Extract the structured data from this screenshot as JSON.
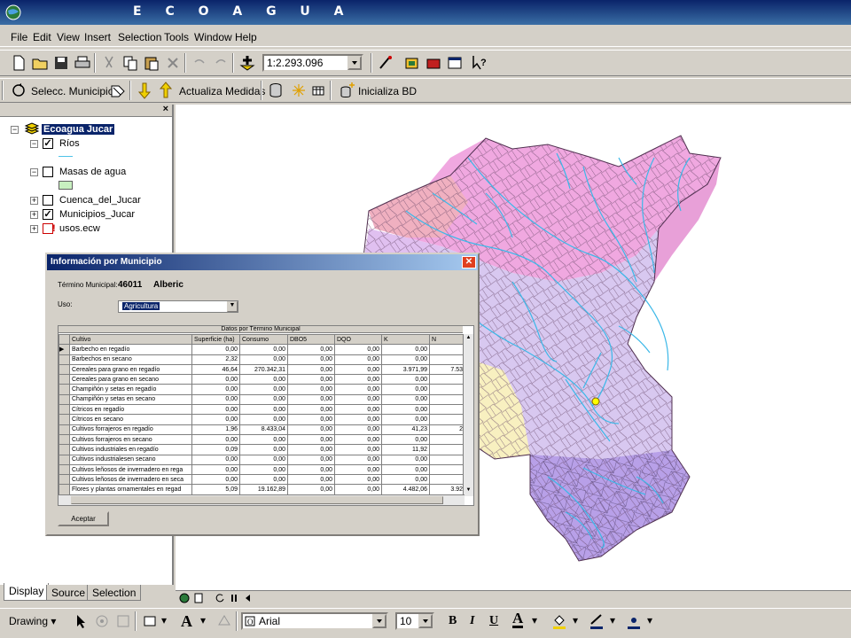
{
  "app": {
    "title": "E C O A G U A"
  },
  "menu": [
    "File",
    "Edit",
    "View",
    "Insert",
    "Selection",
    "Tools",
    "Window",
    "Help"
  ],
  "toolbar": {
    "scale": "1:2.293.096",
    "selecc_municipio": "Selecc. Municipio",
    "actualiza_medidas": "Actualiza Medidas",
    "inicializa_bd": "Inicializa BD"
  },
  "toc": {
    "root": "Ecoagua Jucar",
    "layers": [
      {
        "name": "Ríos",
        "checked": true
      },
      {
        "name": "Masas de agua",
        "checked": false
      },
      {
        "name": "Cuenca_del_Jucar",
        "checked": false
      },
      {
        "name": "Municipios_Jucar",
        "checked": true
      },
      {
        "name": "usos.ecw",
        "checked": false
      }
    ],
    "tabs": [
      "Display",
      "Source",
      "Selection"
    ]
  },
  "drawing": {
    "label": "Drawing",
    "font": "Arial",
    "size": "10"
  },
  "dialog": {
    "title": "Información por Municipio",
    "termino_label": "Término Municipal:",
    "termino_code": "46011",
    "termino_name": "Alberic",
    "uso_label": "Uso:",
    "uso_value": "Agricultura",
    "grid_caption": "Datos por Término Municipal",
    "columns": [
      "Cultivo",
      "Superficie (ha)",
      "Consumo",
      "DBO5",
      "DQO",
      "K",
      "N"
    ],
    "rows": [
      [
        "Barbecho en regadío",
        "0,00",
        "0,00",
        "0,00",
        "0,00",
        "0,00",
        ""
      ],
      [
        "Barbechos en secano",
        "2,32",
        "0,00",
        "0,00",
        "0,00",
        "0,00",
        ""
      ],
      [
        "Cereales para grano en regadío",
        "46,64",
        "270.342,31",
        "0,00",
        "0,00",
        "3.971,99",
        "7.53"
      ],
      [
        "Cereales para grano en secano",
        "0,00",
        "0,00",
        "0,00",
        "0,00",
        "0,00",
        ""
      ],
      [
        "Champiñón y setas en regadío",
        "0,00",
        "0,00",
        "0,00",
        "0,00",
        "0,00",
        ""
      ],
      [
        "Champiñón y setas en secano",
        "0,00",
        "0,00",
        "0,00",
        "0,00",
        "0,00",
        ""
      ],
      [
        "Cítricos en regadío",
        "0,00",
        "0,00",
        "0,00",
        "0,00",
        "0,00",
        ""
      ],
      [
        "Cítricos en secano",
        "0,00",
        "0,00",
        "0,00",
        "0,00",
        "0,00",
        ""
      ],
      [
        "Cultivos forrajeros en regadío",
        "1,96",
        "8.433,04",
        "0,00",
        "0,00",
        "41,23",
        "2"
      ],
      [
        "Cultivos forrajeros en secano",
        "0,00",
        "0,00",
        "0,00",
        "0,00",
        "0,00",
        ""
      ],
      [
        "Cultivos industriales en regadío",
        "0,09",
        "0,00",
        "0,00",
        "0,00",
        "11,92",
        ""
      ],
      [
        "Cultivos industrialesen secano",
        "0,00",
        "0,00",
        "0,00",
        "0,00",
        "0,00",
        ""
      ],
      [
        "Cultivos leñosos de invernadero en rega",
        "0,00",
        "0,00",
        "0,00",
        "0,00",
        "0,00",
        ""
      ],
      [
        "Cultivos leñosos de invernadero en seca",
        "0,00",
        "0,00",
        "0,00",
        "0,00",
        "0,00",
        ""
      ],
      [
        "Flores y plantas ornamentales en regad",
        "5,09",
        "19.162,89",
        "0,00",
        "0,00",
        "4.482,06",
        "3.92"
      ]
    ],
    "ok_label": "Aceptar"
  },
  "colors": {
    "title_bar": "#0a246a",
    "river": "#4fc3e8",
    "selected_municipality": "#ffff00"
  }
}
